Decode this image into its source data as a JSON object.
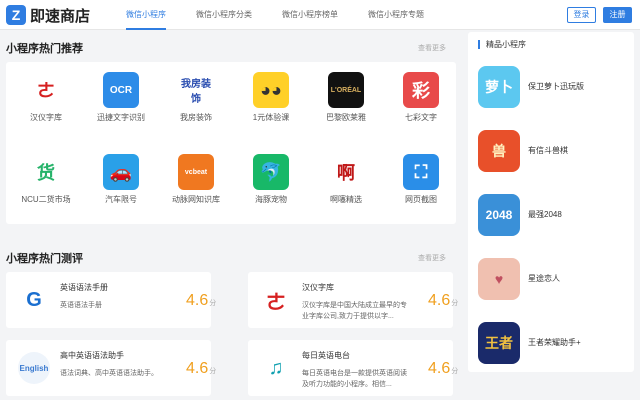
{
  "header": {
    "logo_mark": "Z",
    "logo_text": "即速商店",
    "nav": [
      "微信小程序",
      "微信小程序分类",
      "微信小程序榜单",
      "微信小程序专题"
    ],
    "login": "登录",
    "register": "注册"
  },
  "hot": {
    "title": "小程序热门推荐",
    "more": "查看更多",
    "apps": [
      {
        "name": "汉仪字库",
        "icon": "hanyi-logo-icon",
        "glyph": "ㄜ",
        "bg": "#ffffff",
        "fg": "#d62020"
      },
      {
        "name": "迅捷文字识别",
        "icon": "ocr-eye-icon",
        "glyph": "OCR",
        "bg": "#2d8ce8",
        "fg": "#ffffff"
      },
      {
        "name": "我房装饰",
        "icon": "wofang-logo-icon",
        "glyph": "我房装饰",
        "bg": "#ffffff",
        "fg": "#2a4db0"
      },
      {
        "name": "1元体验课",
        "icon": "yellow-chick-icon",
        "glyph": "◕◕",
        "bg": "#ffd028",
        "fg": "#333333"
      },
      {
        "name": "巴黎欧莱雅",
        "icon": "loreal-logo-icon",
        "glyph": "L'ORÉAL",
        "bg": "#111111",
        "fg": "#d8b060"
      },
      {
        "name": "七彩文字",
        "icon": "qicai-logo-icon",
        "glyph": "彩",
        "bg": "#e84a4a",
        "fg": "#ffffff"
      },
      {
        "name": "NCU二货市场",
        "icon": "ncu-market-icon",
        "glyph": "货",
        "bg": "#ffffff",
        "fg": "#26b36a"
      },
      {
        "name": "汽车限号",
        "icon": "car-restriction-icon",
        "glyph": "🚗",
        "bg": "#2aa0e8",
        "fg": "#ffffff"
      },
      {
        "name": "动脉网知识库",
        "icon": "vcbeat-logo-icon",
        "glyph": "vcbeat",
        "bg": "#f07820",
        "fg": "#ffffff"
      },
      {
        "name": "海豚宠物",
        "icon": "dolphin-icon",
        "glyph": "🐬",
        "bg": "#18b868",
        "fg": "#ffffff"
      },
      {
        "name": "啊噻精选",
        "icon": "asai-logo-icon",
        "glyph": "啊",
        "bg": "#ffffff",
        "fg": "#c01818"
      },
      {
        "name": "网页截图",
        "icon": "screenshot-icon",
        "glyph": "⛶",
        "bg": "#2a8ee8",
        "fg": "#ffffff"
      }
    ]
  },
  "reviews": {
    "title": "小程序热门测评",
    "more": "查看更多",
    "unit": "分",
    "items": [
      {
        "title": "英语语法手册",
        "desc": "英语语法手册",
        "score": "4.6",
        "icon": "grammar-g-icon",
        "glyph": "G",
        "bg": "#ffffff",
        "fg": "#1a6fd0"
      },
      {
        "title": "汉仪字库",
        "desc": "汉仪字库是中国大陆成立最早的专业字库公司,致力于提供以字...",
        "score": "4.6",
        "icon": "hanyi-logo-icon",
        "glyph": "ㄜ",
        "bg": "#ffffff",
        "fg": "#d62020"
      },
      {
        "title": "高中英语语法助手",
        "desc": "语法词典、高中英语语法助手。",
        "score": "4.6",
        "icon": "english-icon",
        "glyph": "English",
        "bg": "#eef4fb",
        "fg": "#3a7ad0"
      },
      {
        "title": "每日英语电台",
        "desc": "每日英语电台是一款提供英语阅读及听力功能的小程序。相信...",
        "score": "4.6",
        "icon": "headphones-icon",
        "glyph": "♫",
        "bg": "#ffffff",
        "fg": "#10a0b0"
      }
    ]
  },
  "side": {
    "title": "精品小程序",
    "items": [
      {
        "name": "保卫萝卜迅玩版",
        "icon": "carrot-game-icon",
        "glyph": "萝卜",
        "bg": "#5cc8f0",
        "fg": "#ffffff"
      },
      {
        "name": "有信斗兽棋",
        "icon": "animal-chess-icon",
        "glyph": "兽",
        "bg": "#e8502a",
        "fg": "#fff2c0"
      },
      {
        "name": "最强2048",
        "icon": "2048-icon",
        "glyph": "2048",
        "bg": "#3a90d8",
        "fg": "#ffffff"
      },
      {
        "name": "星途恋人",
        "icon": "star-lover-icon",
        "glyph": "♥",
        "bg": "#f0c0b0",
        "fg": "#c05060"
      },
      {
        "name": "王者荣耀助手+",
        "icon": "honor-of-kings-icon",
        "glyph": "王者",
        "bg": "#1a2a6a",
        "fg": "#f0c040"
      }
    ]
  }
}
